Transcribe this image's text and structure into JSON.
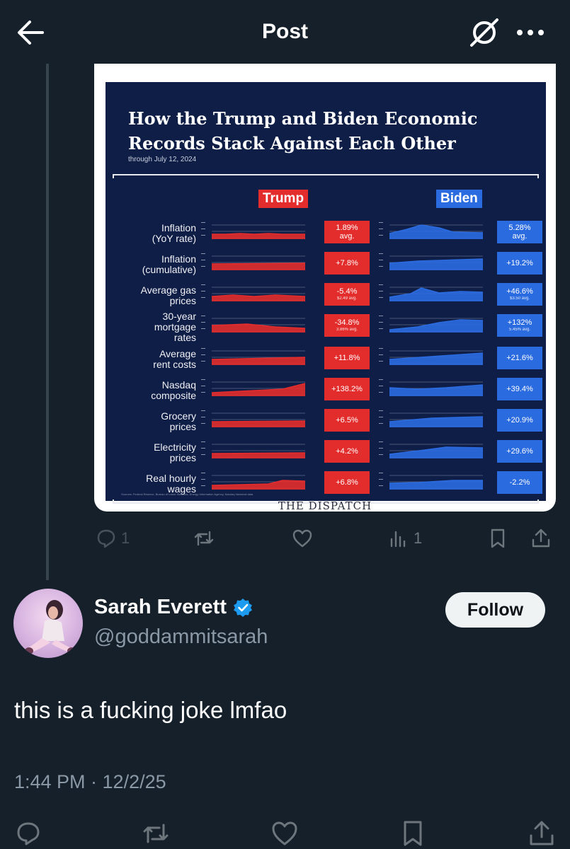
{
  "header": {
    "title": "Post",
    "back_icon": "arrow-left-icon",
    "grok_icon": "grok-icon",
    "more_icon": "more-horizontal-icon"
  },
  "infographic": {
    "title": "How the Trump and Biden Economic\nRecords Stack Against Each Other",
    "subtitle": "through July 12, 2024",
    "trump_label": "Trump",
    "biden_label": "Biden",
    "trump_color": "#e32c2c",
    "biden_color": "#2b6be0",
    "source": "Sources: Federal Reserve, Bureau of Labor Statistics, Energy Information Agency, Nasdaq historical data",
    "publisher": "THE DISPATCH",
    "rows": [
      {
        "label": "Inflation\n(YoY rate)",
        "trump": "1.89%",
        "trump_sub": "avg.",
        "biden": "5.28%",
        "biden_sub": "avg."
      },
      {
        "label": "Inflation\n(cumulative)",
        "trump": "+7.8%",
        "trump_sub": "",
        "biden": "+19.2%",
        "biden_sub": ""
      },
      {
        "label": "Average gas\nprices",
        "trump": "-5.4%",
        "trump_sub": "$2.49 avg.",
        "biden": "+46.6%",
        "biden_sub": "$3.50 avg."
      },
      {
        "label": "30-year\nmortgage\nrates",
        "trump": "-34.8%",
        "trump_sub": "3.86% avg.",
        "biden": "+132%",
        "biden_sub": "5.45% avg."
      },
      {
        "label": "Average\nrent costs",
        "trump": "+11.8%",
        "trump_sub": "",
        "biden": "+21.6%",
        "biden_sub": ""
      },
      {
        "label": "Nasdaq\ncomposite",
        "trump": "+138.2%",
        "trump_sub": "",
        "biden": "+39.4%",
        "biden_sub": ""
      },
      {
        "label": "Grocery\nprices",
        "trump": "+6.5%",
        "trump_sub": "",
        "biden": "+20.9%",
        "biden_sub": ""
      },
      {
        "label": "Electricity\nprices",
        "trump": "+4.2%",
        "trump_sub": "",
        "biden": "+29.6%",
        "biden_sub": ""
      },
      {
        "label": "Real hourly\nwages",
        "trump": "+6.8%",
        "trump_sub": "",
        "biden": "-2.2%",
        "biden_sub": ""
      }
    ]
  },
  "quoted_actions": {
    "reply_count": "1",
    "retweet_count": "",
    "like_count": "",
    "views_count": "1"
  },
  "author": {
    "name": "Sarah Everett",
    "handle": "@goddammitsarah",
    "follow_label": "Follow",
    "verified_color": "#1d9bf0"
  },
  "tweet": {
    "text": "this is a fucking joke lmfao",
    "timestamp": "1:44 PM · 12/2/25"
  }
}
